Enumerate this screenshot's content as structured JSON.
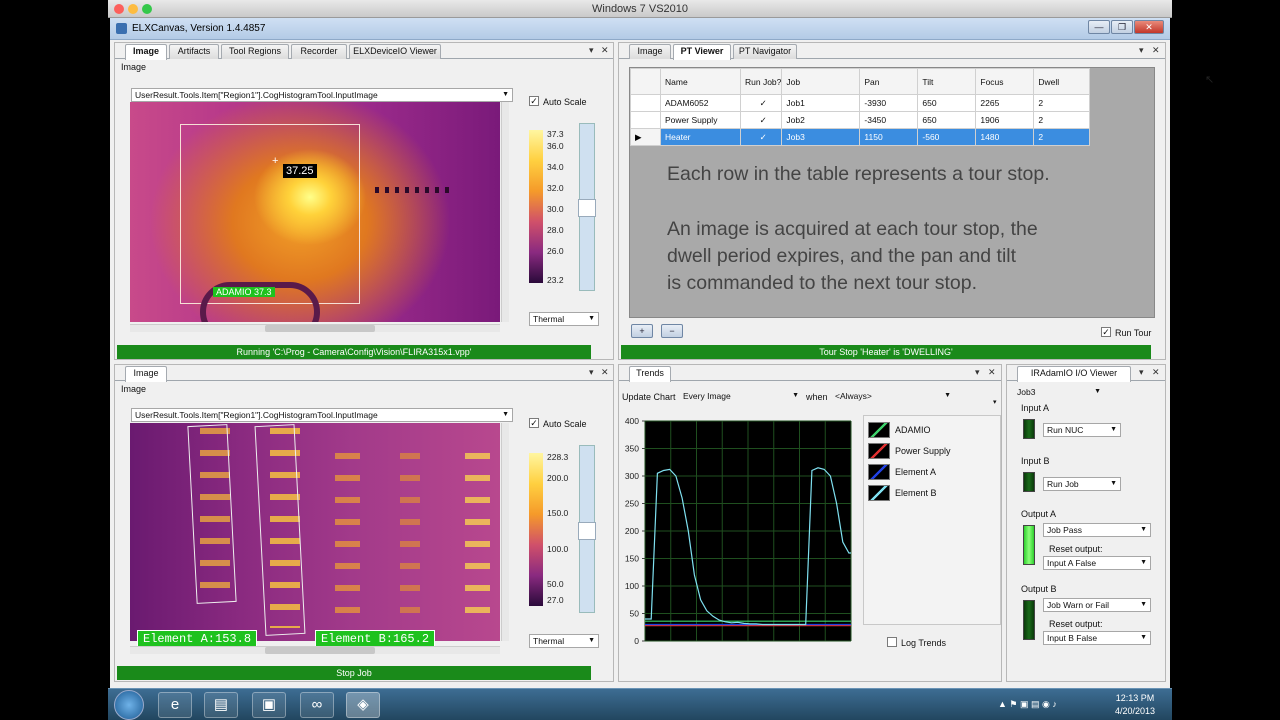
{
  "vm_title": "Windows 7 VS2010",
  "app": {
    "title": "ELXCanvas, Version 1.4.4857",
    "buttons": [
      "—",
      "❐",
      "✕"
    ]
  },
  "top_left": {
    "tabs": [
      "Image",
      "Artifacts",
      "Tool Regions",
      "Recorder",
      "ELXDeviceIO Viewer"
    ],
    "panel_label": "Image",
    "source_combo": "UserResult.Tools.Item[\"Region1\"].CogHistogramTool.InputImage",
    "auto_scale_label": "Auto Scale",
    "scale_ticks": [
      "37.3",
      "36.0",
      "34.0",
      "32.0",
      "30.0",
      "28.0",
      "26.0",
      "23.2"
    ],
    "palette": "Thermal",
    "cursor_value": "37.25",
    "region_label": "ADAMIO 37.3",
    "status": "Running 'C:\\Prog - Camera\\Config\\Vision\\FLIRA315x1.vpp'"
  },
  "bottom_left": {
    "tab": "Image",
    "panel_label": "Image",
    "source_combo": "UserResult.Tools.Item[\"Region1\"].CogHistogramTool.InputImage",
    "auto_scale_label": "Auto Scale",
    "scale_ticks": [
      "228.3",
      "200.0",
      "150.0",
      "100.0",
      "50.0",
      "27.0"
    ],
    "palette": "Thermal",
    "element_a": "Element A:153.8",
    "element_b": "Element B:165.2",
    "status": "Stop Job"
  },
  "top_right": {
    "tabs": [
      "Image",
      "PT Viewer",
      "PT Navigator"
    ],
    "columns": [
      "Name",
      "Run Job?",
      "Job",
      "Pan",
      "Tilt",
      "Focus",
      "Dwell"
    ],
    "rows": [
      {
        "name": "ADAM6052",
        "run": "✓",
        "job": "Job1",
        "pan": "-3930",
        "tilt": "650",
        "focus": "2265",
        "dwell": "2"
      },
      {
        "name": "Power Supply",
        "run": "✓",
        "job": "Job2",
        "pan": "-3450",
        "tilt": "650",
        "focus": "1906",
        "dwell": "2"
      },
      {
        "name": "Heater",
        "run": "✓",
        "job": "Job3",
        "pan": "1150",
        "tilt": "-560",
        "focus": "1480",
        "dwell": "2"
      }
    ],
    "caption_1": "Each row in the table represents a tour stop.",
    "caption_2": "An image is acquired at each tour stop, the",
    "caption_3": "dwell period expires, and the pan and tilt",
    "caption_4": "is commanded to the next tour stop.",
    "add_label": "+",
    "remove_label": "−",
    "run_tour_label": "Run Tour",
    "status": "Tour Stop 'Heater' is 'DWELLING'"
  },
  "trends": {
    "tab": "Trends",
    "update_label": "Update Chart",
    "update_value": "Every Image",
    "when_label": "when",
    "when_value": "<Always>",
    "log_label": "Log Trends",
    "legend": [
      {
        "name": "ADAMIO",
        "color": "#3dd06a"
      },
      {
        "name": "Power Supply",
        "color": "#e03030"
      },
      {
        "name": "Element A",
        "color": "#2040e0"
      },
      {
        "name": "Element B",
        "color": "#7fe0f0"
      }
    ]
  },
  "io_viewer": {
    "tab": "IRAdamIO I/O Viewer",
    "job": "Job3",
    "input_a_label": "Input A",
    "input_a_value": "Run NUC",
    "input_b_label": "Input B",
    "input_b_value": "Run Job",
    "output_a_label": "Output A",
    "output_a_value": "Job Pass",
    "reset_label_a": "Reset output:",
    "reset_a_value": "Input A False",
    "output_b_label": "Output B",
    "output_b_value": "Job Warn or Fail",
    "reset_label_b": "Reset output:",
    "reset_b_value": "Input B False"
  },
  "taskbar": {
    "time": "12:13 PM",
    "date": "4/20/2013"
  },
  "chart_data": {
    "type": "line",
    "title": "",
    "xlabel": "",
    "ylabel": "",
    "ylim": [
      0,
      400
    ],
    "yticks": [
      0,
      50,
      100,
      150,
      200,
      250,
      300,
      350,
      400
    ],
    "grid": true,
    "legend_position": "right",
    "x": [
      0,
      3,
      6,
      9,
      12,
      15,
      18,
      21,
      24,
      27,
      30,
      33,
      36,
      39,
      42,
      45,
      48,
      51,
      54,
      57,
      60,
      63,
      66,
      69,
      72,
      75,
      78,
      81,
      84,
      87,
      90,
      93,
      96,
      99,
      100
    ],
    "series": [
      {
        "name": "ADAMIO",
        "color": "#3dd06a",
        "values": [
          36,
          36,
          36,
          36,
          36,
          36,
          36,
          36,
          36,
          36,
          36,
          36,
          36,
          36,
          36,
          36,
          36,
          36,
          36,
          36,
          36,
          36,
          36,
          36,
          36,
          36,
          36,
          36,
          36,
          36,
          36,
          36,
          36,
          36,
          36
        ]
      },
      {
        "name": "Power Supply",
        "color": "#e03030",
        "values": [
          28,
          28,
          28,
          28,
          28,
          28,
          28,
          28,
          28,
          28,
          28,
          28,
          28,
          28,
          28,
          28,
          28,
          28,
          28,
          28,
          28,
          28,
          28,
          28,
          28,
          28,
          28,
          28,
          28,
          28,
          28,
          28,
          28,
          28,
          28
        ]
      },
      {
        "name": "Element A",
        "color": "#2040e0",
        "values": [
          30,
          30,
          30,
          30,
          30,
          30,
          30,
          30,
          30,
          30,
          30,
          30,
          30,
          30,
          30,
          30,
          30,
          30,
          30,
          30,
          30,
          30,
          30,
          30,
          30,
          30,
          30,
          30,
          30,
          30,
          30,
          30,
          30,
          30,
          30
        ]
      },
      {
        "name": "Element B",
        "color": "#7fe0f0",
        "values": [
          40,
          40,
          305,
          310,
          312,
          300,
          260,
          200,
          120,
          75,
          55,
          45,
          38,
          35,
          33,
          34,
          32,
          31,
          31,
          30,
          30,
          30,
          30,
          30,
          30,
          30,
          30,
          310,
          315,
          312,
          300,
          250,
          180,
          160,
          160
        ]
      }
    ]
  }
}
